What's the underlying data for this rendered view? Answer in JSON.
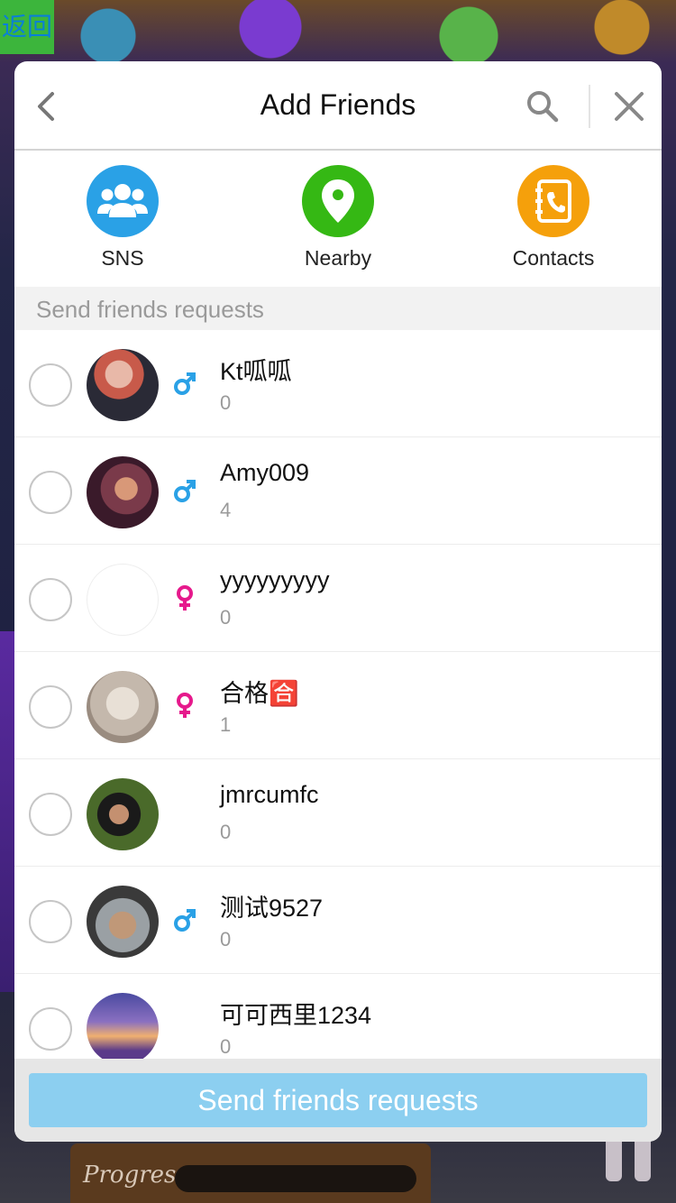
{
  "background": {
    "back_badge_label": "返回",
    "progress_label": "Progress"
  },
  "header": {
    "title": "Add Friends"
  },
  "actions": [
    {
      "label": "SNS",
      "color": "#2aa1e6",
      "icon": "people-icon"
    },
    {
      "label": "Nearby",
      "color": "#35b814",
      "icon": "location-pin-icon"
    },
    {
      "label": "Contacts",
      "color": "#f5a00b",
      "icon": "contacts-book-icon"
    }
  ],
  "section": {
    "title": "Send friends requests"
  },
  "friends": [
    {
      "name": "Kt呱呱",
      "count": "0",
      "gender": "male",
      "avatar_colors": [
        "#c85a4a",
        "#2a2a36"
      ]
    },
    {
      "name": "Amy009",
      "count": "4",
      "gender": "male",
      "avatar_colors": [
        "#7a3a4a",
        "#3a1a2a"
      ]
    },
    {
      "name": "yyyyyyyyy",
      "count": "0",
      "gender": "female",
      "avatar_colors": [
        "#ffffff",
        "#f4f4f4"
      ]
    },
    {
      "name": "合格🈴",
      "count": "1",
      "gender": "female",
      "avatar_colors": [
        "#d8cfc4",
        "#9a8c80"
      ]
    },
    {
      "name": "jmrcumfc",
      "count": "0",
      "gender": "none",
      "avatar_colors": [
        "#4a6a2a",
        "#1a1a1a"
      ]
    },
    {
      "name": "测试9527",
      "count": "0",
      "gender": "male",
      "avatar_colors": [
        "#9aa0a4",
        "#3a3a3a"
      ]
    },
    {
      "name": "可可西里1234",
      "count": "0",
      "gender": "none",
      "avatar_colors": [
        "#4a4aa0",
        "#e09050"
      ]
    }
  ],
  "footer": {
    "button_label": "Send friends requests"
  },
  "colors": {
    "male": "#2aa1e6",
    "female": "#e6198c",
    "send_button": "#8ccff0"
  }
}
